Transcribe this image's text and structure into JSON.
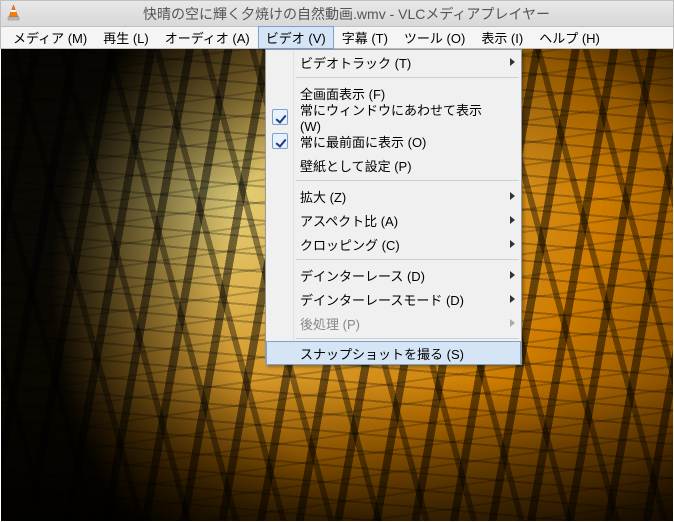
{
  "titlebar": {
    "title": "快晴の空に輝く夕焼けの自然動画.wmv - VLCメディアプレイヤー"
  },
  "menubar": {
    "media": "メディア (M)",
    "playback": "再生 (L)",
    "audio": "オーディオ (A)",
    "video": "ビデオ (V)",
    "subtitle": "字幕 (T)",
    "tools": "ツール (O)",
    "view": "表示 (I)",
    "help": "ヘルプ (H)"
  },
  "video_menu": {
    "video_track": "ビデオトラック (T)",
    "fullscreen": "全画面表示 (F)",
    "fit_window": "常にウィンドウにあわせて表示 (W)",
    "always_on_top": "常に最前面に表示 (O)",
    "set_wallpaper": "壁紙として設定 (P)",
    "zoom": "拡大 (Z)",
    "aspect_ratio": "アスペクト比 (A)",
    "crop": "クロッピング (C)",
    "deinterlace": "デインターレース (D)",
    "deinterlace_mode": "デインターレースモード (D)",
    "post_processing": "後処理 (P)",
    "take_snapshot": "スナップショットを撮る (S)"
  },
  "state": {
    "fit_window_checked": true,
    "always_on_top_checked": true,
    "highlighted_item": "take_snapshot"
  }
}
